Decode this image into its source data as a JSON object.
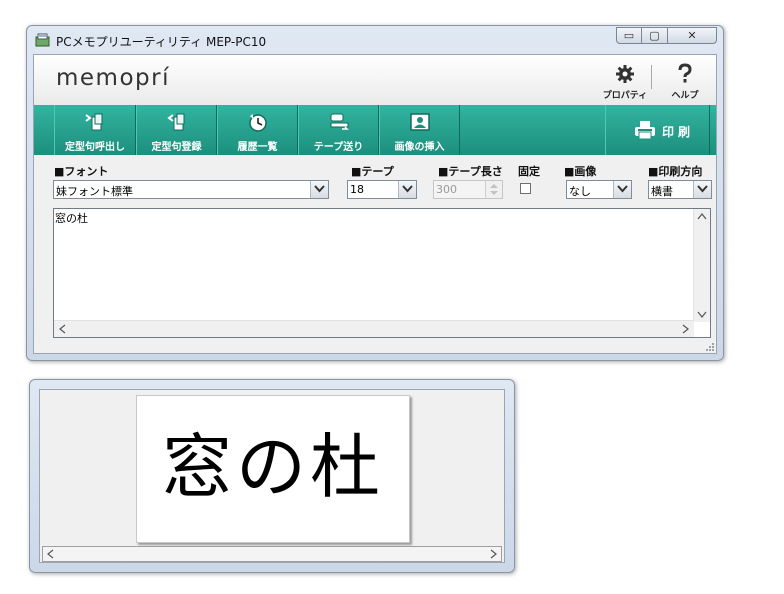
{
  "window": {
    "title": "PCメモプリユーティリティ MEP-PC10",
    "min_glyph": "▭",
    "max_glyph": "▢",
    "close_glyph": "✕"
  },
  "brand": {
    "logo": "memoprí",
    "properties_label": "プロパティ",
    "help_label": "ヘルプ"
  },
  "toolbar": {
    "buttons": [
      {
        "label": "定型句呼出し",
        "icon": "phrase-recall-icon"
      },
      {
        "label": "定型句登録",
        "icon": "phrase-register-icon"
      },
      {
        "label": "履歴一覧",
        "icon": "history-icon"
      },
      {
        "label": "テープ送り",
        "icon": "tape-feed-icon"
      },
      {
        "label": "画像の挿入",
        "icon": "insert-image-icon"
      }
    ],
    "print_label": "印刷"
  },
  "options": {
    "font_label": "■フォント",
    "font_value": "妹フォント標準",
    "tape_label": "■テープ",
    "tape_value": "18",
    "length_label": "■テープ長さ",
    "length_value": "300",
    "fixed_label": "固定",
    "fixed_checked": false,
    "image_label": "■画像",
    "image_value": "なし",
    "direction_label": "■印刷方向",
    "direction_value": "横書"
  },
  "editor": {
    "text": "窓の杜"
  },
  "preview": {
    "label_text": "窓の杜"
  },
  "colors": {
    "toolbar_teal": "#23a08d",
    "window_frame": "#cbd8e8"
  }
}
